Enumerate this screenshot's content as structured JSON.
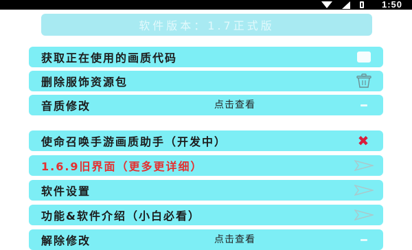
{
  "status_bar": {
    "time": "1:50"
  },
  "version_banner": "软件版本：1.7正式版",
  "menu": [
    {
      "label": "获取正在使用的画质代码",
      "sub": "",
      "icon": "copy-icon"
    },
    {
      "label": "删除服饰资源包",
      "sub": "",
      "icon": "trash-icon"
    },
    {
      "label": "音质修改",
      "sub": "点击查看",
      "icon": "dash-icon"
    },
    {
      "label": "使命召唤手游画质助手（开发中）",
      "sub": "",
      "icon": "close-icon"
    },
    {
      "label": "1.6.9旧界面（更多更详细）",
      "sub": "",
      "icon": "send-icon"
    },
    {
      "label": "软件设置",
      "sub": "",
      "icon": "send-icon"
    },
    {
      "label": "功能&软件介绍（小白必看）",
      "sub": "",
      "icon": "send-icon"
    },
    {
      "label": "解除修改",
      "sub": "点击查看",
      "icon": "dash-icon"
    }
  ],
  "colors": {
    "item_bg": "#7deef5",
    "banner_bg": "#a8eaf2",
    "red_text": "#e53030",
    "close_icon": "#d81e3c"
  }
}
